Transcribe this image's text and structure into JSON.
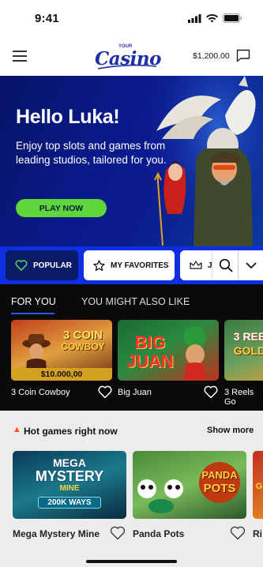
{
  "status_bar": {
    "time": "9:41"
  },
  "header": {
    "logo_small": "YOUR",
    "logo_main": "Casino",
    "balance": "$1,200.00"
  },
  "hero": {
    "title": "Hello Luka!",
    "subtitle": "Enjoy top slots and games from leading studios, tailored for you.",
    "cta": "PLAY NOW"
  },
  "categories": [
    {
      "label": "POPULAR"
    },
    {
      "label": "MY FAVORITES"
    },
    {
      "label": "J"
    }
  ],
  "tabs": [
    {
      "label": "FOR YOU"
    },
    {
      "label": "YOU MIGHT ALSO LIKE"
    }
  ],
  "for_you": [
    {
      "name": "3 Coin Cowboy",
      "art_line1": "3 COIN",
      "art_line2": "COWBOY",
      "jackpot": "$10.000,00"
    },
    {
      "name": "Big Juan",
      "art_line1": "BIG",
      "art_line2": "JUAN"
    },
    {
      "name": "3 Reels Go",
      "art_line1": "3 REE",
      "art_line2": "GOLD"
    }
  ],
  "hot": {
    "title": "Hot games right now",
    "show_more": "Show more",
    "games": [
      {
        "name": "Mega Mystery Mine",
        "art_line1": "MEGA",
        "art_line2": "MYSTERY",
        "art_line3": "MINE",
        "art_line4": "200K WAYS"
      },
      {
        "name": "Panda Pots",
        "art_line1": "PANDA",
        "art_line2": "POTS"
      },
      {
        "name": "Ri",
        "art_line1": "G"
      }
    ]
  },
  "colors": {
    "brand_blue": "#0d2fe0",
    "hero_bg": "#0a1a8a",
    "cta_green": "#5fd63a",
    "tab_underline": "#2b56ff"
  }
}
